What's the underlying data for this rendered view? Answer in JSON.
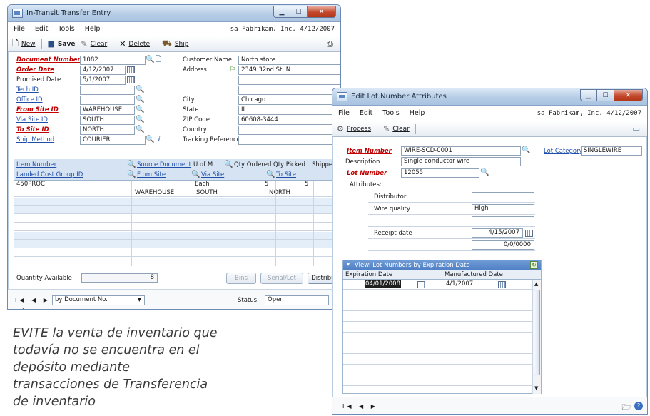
{
  "transfer": {
    "title": "In-Transit Transfer Entry",
    "menu": [
      "File",
      "Edit",
      "Tools",
      "Help"
    ],
    "context": "sa  Fabrikam, Inc.  4/12/2007",
    "toolbar": {
      "new": "New",
      "save": "Save",
      "clear": "Clear",
      "delete": "Delete",
      "ship": "Ship"
    },
    "labels": {
      "document_number": "Document Number",
      "order_date": "Order Date",
      "promised_date": "Promised Date",
      "tech_id": "Tech ID",
      "office_id": "Office ID",
      "from_site": "From Site ID",
      "via_site": "Via Site ID",
      "to_site": "To Site ID",
      "ship_method": "Ship Method",
      "customer_name": "Customer Name",
      "address": "Address",
      "city": "City",
      "state": "State",
      "zip": "ZIP Code",
      "country": "Country",
      "tracking": "Tracking Reference"
    },
    "values": {
      "document_number": "1082",
      "order_date": "4/12/2007",
      "promised_date": "5/1/2007",
      "tech_id": "",
      "office_id": "",
      "from_site": "WAREHOUSE",
      "via_site": "SOUTH",
      "to_site": "NORTH",
      "ship_method": "COURIER",
      "customer_name": "North store",
      "address": "2349 32nd St. N",
      "city": "Chicago",
      "state": "IL",
      "zip": "60608-3444",
      "country": "",
      "tracking": ""
    },
    "grid": {
      "headers": {
        "item_number": "Item Number",
        "source_document": "Source Document",
        "u_of_m": "U of M",
        "qty_ordered": "Qty Ordered",
        "qty_picked": "Qty Picked",
        "shipped": "Shipped",
        "landed_cost": "Landed Cost Group ID",
        "from_site": "From Site",
        "via_site": "Via Site",
        "to_site": "To Site"
      },
      "row1": {
        "item": "450PROC",
        "uofm": "Each",
        "ordered": "5",
        "picked": "5"
      },
      "row2": {
        "from": "WAREHOUSE",
        "via": "SOUTH",
        "to": "NORTH"
      }
    },
    "quantity_available_label": "Quantity Available",
    "quantity_available": "8",
    "buttons": {
      "bins": "Bins",
      "serial": "Serial/Lot",
      "distribution": "Distribution"
    },
    "nav": "I◀ ◀ ▶ ▶I",
    "sort_by": "by Document No.",
    "status_label": "Status",
    "status": "Open"
  },
  "lot": {
    "title": "Edit Lot Number Attributes",
    "menu": [
      "File",
      "Edit",
      "Tools",
      "Help"
    ],
    "context": "sa  Fabrikam, Inc.  4/12/2007",
    "toolbar": {
      "process": "Process",
      "clear": "Clear"
    },
    "labels": {
      "item_number": "Item Number",
      "description": "Description",
      "lot_number": "Lot Number",
      "lot_category": "Lot Category",
      "attributes": "Attributes:",
      "distributor": "Distributor",
      "wire_quality": "Wire quality",
      "receipt_date": "Receipt date"
    },
    "values": {
      "item_number": "WIRE-SCD-0001",
      "description": "Single conductor wire",
      "lot_number": "12055",
      "lot_category": "SINGLEWIRE",
      "distributor": "",
      "wire_quality": "High",
      "receipt_date": "4/15/2007",
      "blank_date": "0/0/0000"
    },
    "view_label": "View: Lot Numbers by Expiration Date",
    "grid_headers": {
      "expiration": "Expiration Date",
      "manufactured": "Manufactured Date"
    },
    "grid_row": {
      "expiration": "04/01/2008",
      "manufactured": "4/1/2007"
    },
    "nav": "I◀ ◀ ▶ ▶I"
  },
  "caption": "EVITE la venta de inventario que todavía no se encuentra en el depósito mediante transacciones de Transferencia de inventario"
}
